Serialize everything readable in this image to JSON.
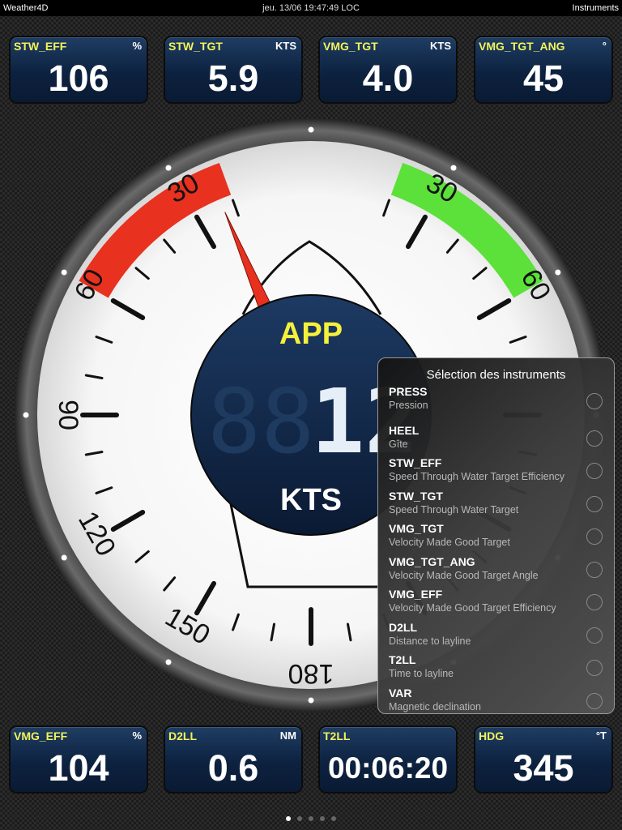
{
  "status_bar": {
    "app": "Weather4D",
    "datetime": "jeu. 13/06 19:47:49 LOC",
    "right_label": "Instruments"
  },
  "top_tiles": [
    {
      "label": "STW_EFF",
      "unit": "%",
      "value": "106"
    },
    {
      "label": "STW_TGT",
      "unit": "KTS",
      "value": "5.9"
    },
    {
      "label": "VMG_TGT",
      "unit": "KTS",
      "value": "4.0"
    },
    {
      "label": "VMG_TGT_ANG",
      "unit": "°",
      "value": "45"
    }
  ],
  "bottom_tiles": [
    {
      "label": "VMG_EFF",
      "unit": "%",
      "value": "104"
    },
    {
      "label": "D2LL",
      "unit": "NM",
      "value": "0.6"
    },
    {
      "label": "T2LL",
      "unit": "",
      "value": "00:06:20"
    },
    {
      "label": "HDG",
      "unit": "°T",
      "value": "345"
    }
  ],
  "gauge": {
    "mode": "APP",
    "unit": "KTS",
    "digital_value": "12",
    "wind_angle_deg": -23,
    "left_labels": [
      "30",
      "60",
      "90",
      "120",
      "150"
    ],
    "right_labels": [
      "30",
      "60"
    ],
    "bottom_label": "180",
    "colors": {
      "port": "#e8311f",
      "starboard": "#5ce03a",
      "hub": "#12284a",
      "mode": "#f5f03c",
      "needle": "#e8301f"
    }
  },
  "popover": {
    "title": "Sélection des instruments",
    "items": [
      {
        "code": "PRESS",
        "desc": "Pression"
      },
      {
        "code": "HEEL",
        "desc": "Gîte"
      },
      {
        "code": "STW_EFF",
        "desc": "Speed Through Water Target Efficiency"
      },
      {
        "code": "STW_TGT",
        "desc": "Speed Through Water Target"
      },
      {
        "code": "VMG_TGT",
        "desc": "Velocity Made Good Target"
      },
      {
        "code": "VMG_TGT_ANG",
        "desc": "Velocity Made Good Target Angle"
      },
      {
        "code": "VMG_EFF",
        "desc": "Velocity Made Good Target Efficiency"
      },
      {
        "code": "D2LL",
        "desc": "Distance to layline"
      },
      {
        "code": "T2LL",
        "desc": "Time to layline"
      },
      {
        "code": "VAR",
        "desc": "Magnetic declination"
      }
    ]
  },
  "pager": {
    "count": 5,
    "active": 0
  }
}
